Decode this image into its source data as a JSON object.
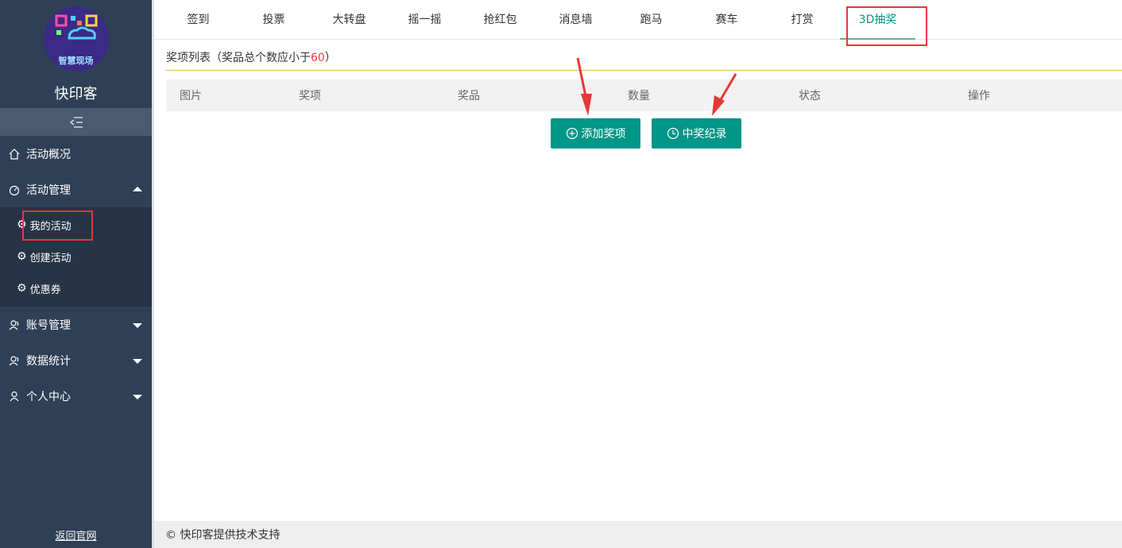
{
  "sidebar": {
    "logo_text": "智慧现场",
    "brand": "快印客",
    "collapse_icon": "collapse-icon",
    "menu": [
      {
        "label": "活动概况",
        "icon": "home-icon"
      },
      {
        "label": "活动管理",
        "icon": "dashboard-icon",
        "expanded": true,
        "children": [
          {
            "label": "我的活动",
            "icon": "gear-icon"
          },
          {
            "label": "创建活动",
            "icon": "gear-icon"
          },
          {
            "label": "优惠券",
            "icon": "gear-icon"
          }
        ]
      },
      {
        "label": "账号管理",
        "icon": "users-icon"
      },
      {
        "label": "数据统计",
        "icon": "users-icon"
      },
      {
        "label": "个人中心",
        "icon": "user-icon"
      }
    ],
    "back_link": "返回官网"
  },
  "tabs": [
    "签到",
    "投票",
    "大转盘",
    "摇一摇",
    "抢红包",
    "消息墙",
    "跑马",
    "赛车",
    "打赏",
    "3D抽奖"
  ],
  "active_tab": "3D抽奖",
  "list": {
    "title_prefix": "奖项列表（奖品总个数应小于",
    "title_number": "60",
    "title_suffix": "）",
    "columns": [
      "图片",
      "奖项",
      "奖品",
      "数量",
      "状态",
      "操作"
    ]
  },
  "buttons": {
    "add_prize": "添加奖项",
    "records": "中奖纪录"
  },
  "footer": "© 快印客提供技术支持",
  "colors": {
    "sidebar": "#2f4056",
    "accent": "#009688",
    "annotation": "#e53935"
  }
}
